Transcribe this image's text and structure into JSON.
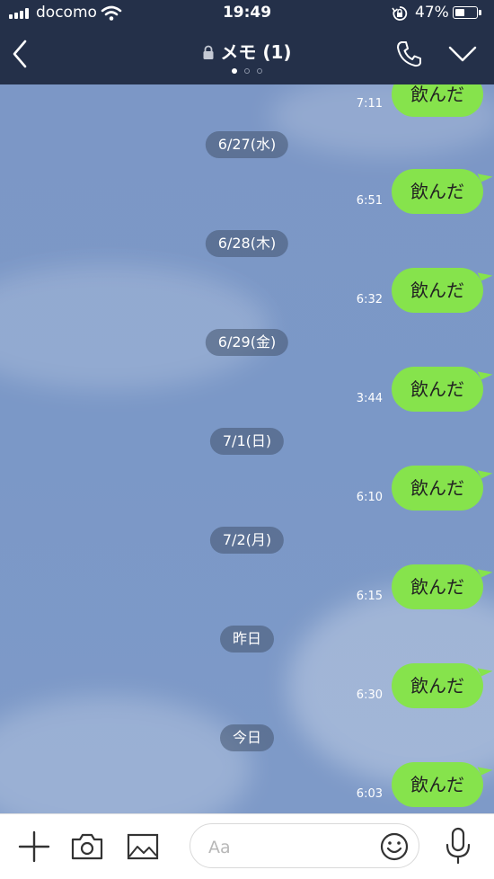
{
  "status": {
    "carrier": "docomo",
    "time": "19:49",
    "battery": "47%",
    "battery_level": 0.47
  },
  "header": {
    "title": "メモ (1)",
    "page_count": 3,
    "current_page": 1
  },
  "colors": {
    "header_bg": "#243049",
    "bubble": "#86e34c",
    "chat_bg": "#7d98c6"
  },
  "chat": {
    "top_message": {
      "text": "飲んだ",
      "time": "7:11"
    },
    "groups": [
      {
        "date": "6/27(水)",
        "text": "飲んだ",
        "time": "6:51"
      },
      {
        "date": "6/28(木)",
        "text": "飲んだ",
        "time": "6:32"
      },
      {
        "date": "6/29(金)",
        "text": "飲んだ",
        "time": "3:44"
      },
      {
        "date": "7/1(日)",
        "text": "飲んだ",
        "time": "6:10"
      },
      {
        "date": "7/2(月)",
        "text": "飲んだ",
        "time": "6:15"
      },
      {
        "date": "昨日",
        "text": "飲んだ",
        "time": "6:30"
      },
      {
        "date": "今日",
        "text": "飲んだ",
        "time": "6:03"
      }
    ]
  },
  "input": {
    "placeholder": "Aa"
  },
  "icons": {
    "toolbar": [
      "plus-icon",
      "camera-icon",
      "image-icon"
    ],
    "field": "emoji-icon",
    "right": "microphone-icon",
    "header": [
      "back-icon",
      "lock-icon",
      "phone-icon",
      "chevron-down-icon"
    ]
  }
}
